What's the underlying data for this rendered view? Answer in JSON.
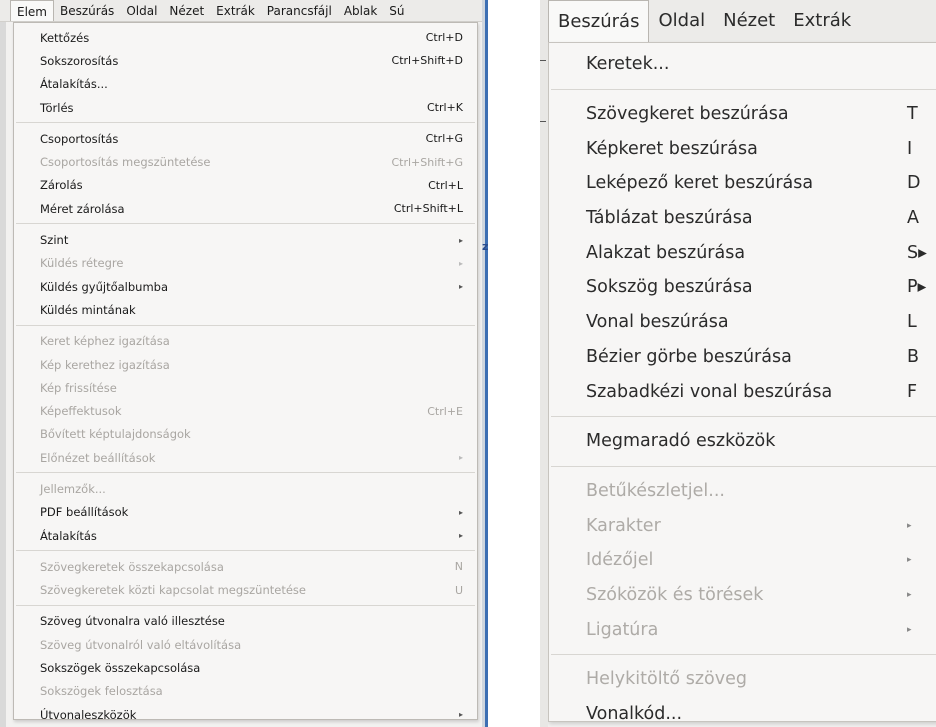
{
  "left": {
    "menubar": [
      "Elem",
      "Beszúrás",
      "Oldal",
      "Nézet",
      "Extrák",
      "Parancsfájl",
      "Ablak",
      "Sú"
    ],
    "fragments": [
      "zé"
    ],
    "menu": [
      {
        "label": "Kettőzés",
        "shortcut": "Ctrl+D"
      },
      {
        "label": "Sokszorosítás",
        "shortcut": "Ctrl+Shift+D"
      },
      {
        "label": "Átalakítás..."
      },
      {
        "label": "Törlés",
        "shortcut": "Ctrl+K"
      },
      {
        "sep": true
      },
      {
        "label": "Csoportosítás",
        "shortcut": "Ctrl+G"
      },
      {
        "label": "Csoportosítás megszüntetése",
        "shortcut": "Ctrl+Shift+G",
        "disabled": true
      },
      {
        "label": "Zárolás",
        "shortcut": "Ctrl+L"
      },
      {
        "label": "Méret zárolása",
        "shortcut": "Ctrl+Shift+L"
      },
      {
        "sep": true
      },
      {
        "label": "Szint",
        "submenu": true
      },
      {
        "label": "Küldés rétegre",
        "submenu": true,
        "disabled": true
      },
      {
        "label": "Küldés gyűjtőalbumba",
        "submenu": true
      },
      {
        "label": "Küldés mintának"
      },
      {
        "sep": true
      },
      {
        "label": "Keret képhez igazítása",
        "disabled": true
      },
      {
        "label": "Kép kerethez igazítása",
        "disabled": true
      },
      {
        "label": "Kép frissítése",
        "disabled": true
      },
      {
        "label": "Képeffektusok",
        "shortcut": "Ctrl+E",
        "disabled": true
      },
      {
        "label": "Bővített képtulajdonságok",
        "disabled": true
      },
      {
        "label": "Előnézet beállítások",
        "submenu": true,
        "disabled": true
      },
      {
        "sep": true
      },
      {
        "label": "Jellemzők...",
        "disabled": true
      },
      {
        "label": "PDF beállítások",
        "submenu": true
      },
      {
        "label": "Átalakítás",
        "submenu": true
      },
      {
        "sep": true
      },
      {
        "label": "Szövegkeretek összekapcsolása",
        "shortcut": "N",
        "disabled": true
      },
      {
        "label": "Szövegkeretek közti kapcsolat megszüntetése",
        "shortcut": "U",
        "disabled": true
      },
      {
        "sep": true
      },
      {
        "label": "Szöveg útvonalra való illesztése"
      },
      {
        "label": "Szöveg útvonalról való eltávolítása",
        "disabled": true
      },
      {
        "label": "Sokszögek összekapcsolása"
      },
      {
        "label": "Sokszögek felosztása",
        "disabled": true
      },
      {
        "label": "Útvonaleszközök",
        "submenu": true
      }
    ]
  },
  "right": {
    "menubar": [
      "Beszúrás",
      "Oldal",
      "Nézet",
      "Extrák"
    ],
    "menu": [
      {
        "label": "Keretek..."
      },
      {
        "sep": true
      },
      {
        "label": "Szövegkeret beszúrása",
        "shortcut": "T"
      },
      {
        "label": "Képkeret beszúrása",
        "shortcut": "I"
      },
      {
        "label": "Leképező keret beszúrása",
        "shortcut": "D"
      },
      {
        "label": "Táblázat beszúrása",
        "shortcut": "A"
      },
      {
        "label": "Alakzat beszúrása",
        "shortcut": "S▸"
      },
      {
        "label": "Sokszög beszúrása",
        "shortcut": "P▸"
      },
      {
        "label": "Vonal beszúrása",
        "shortcut": "L"
      },
      {
        "label": "Bézier görbe beszúrása",
        "shortcut": "B"
      },
      {
        "label": "Szabadkézi vonal beszúrása",
        "shortcut": "F"
      },
      {
        "sep": true
      },
      {
        "label": "Megmaradó eszközök"
      },
      {
        "sep": true
      },
      {
        "label": "Betűkészletjel...",
        "disabled": true
      },
      {
        "label": "Karakter",
        "submenu": true,
        "disabled": true
      },
      {
        "label": "Idézőjel",
        "submenu": true,
        "disabled": true
      },
      {
        "label": "Szóközök és törések",
        "submenu": true,
        "disabled": true
      },
      {
        "label": "Ligatúra",
        "submenu": true,
        "disabled": true
      },
      {
        "sep": true
      },
      {
        "label": "Helykitöltő szöveg",
        "disabled": true
      },
      {
        "label": "Vonalkód..."
      }
    ]
  },
  "icons": {
    "submenu": "small-right-triangle-icon"
  }
}
